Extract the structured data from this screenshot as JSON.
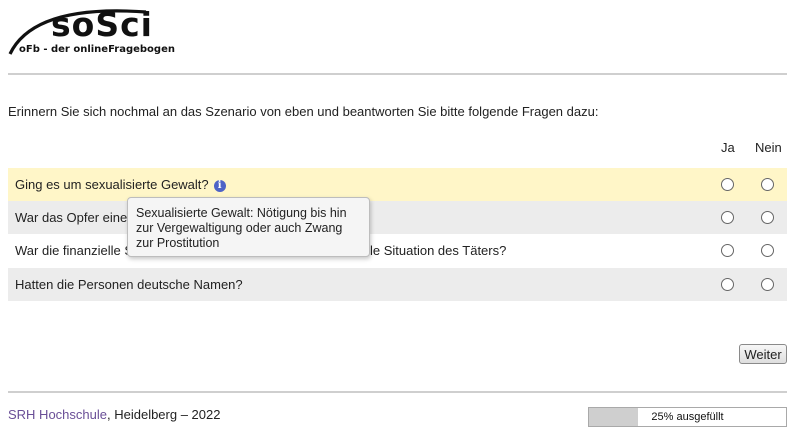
{
  "logo": {
    "wordmark": "soSci",
    "tagline": "oFb - der onlineFragebogen"
  },
  "intro_text": "Erinnern Sie sich nochmal an das Szenario von eben und beantworten Sie bitte folgende Fragen dazu:",
  "columns": {
    "yes": "Ja",
    "no": "Nein"
  },
  "questions": [
    {
      "text": "Ging es um sexualisierte Gewalt?",
      "has_info": true,
      "highlighted": true
    },
    {
      "text": "War das Opfer eine"
    },
    {
      "text": "War die finanzielle S",
      "text_end": "le Situation des Täters?"
    },
    {
      "text": "Hatten die Personen deutsche Namen?"
    }
  ],
  "info_icon": "i",
  "tooltip": "Sexualisierte Gewalt: Nötigung bis hin zur Vergewaltigung oder auch Zwang zur Prostitution",
  "next_button": "Weiter",
  "footer": {
    "organization": "SRH Hochschule",
    "rest": ", Heidelberg – 2022"
  },
  "progress": {
    "label": "25% ausgefüllt",
    "percent": 25
  },
  "colors": {
    "highlight_row": "#fff6c8",
    "alt_row": "#ececec",
    "info_icon": "#4e63c6",
    "link": "#6a4f97"
  }
}
